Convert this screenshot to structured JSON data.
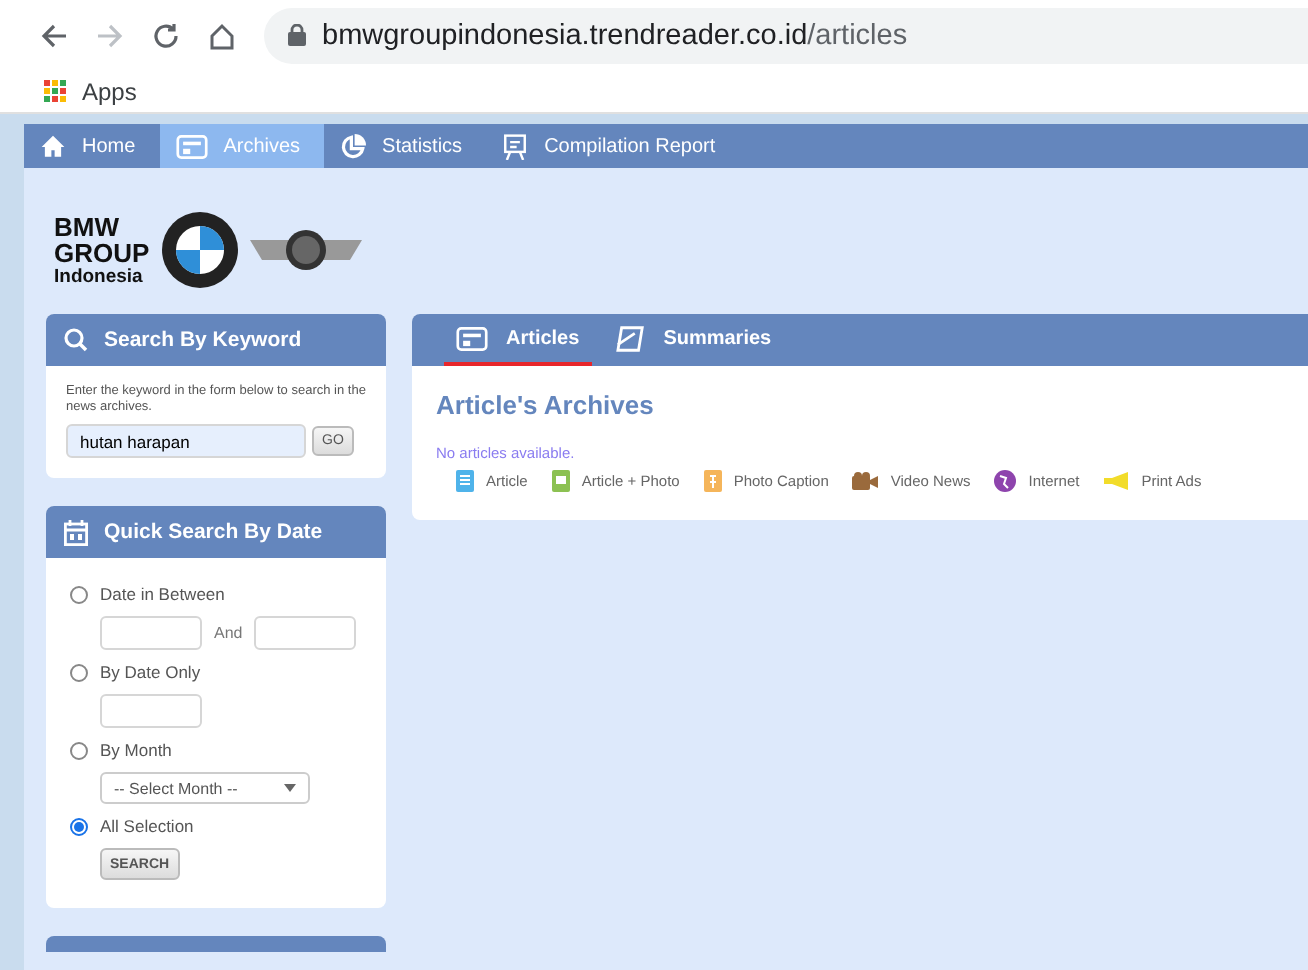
{
  "browser": {
    "url_host": "bmwgroupindonesia.trendreader.co.id",
    "url_path": "/articles",
    "bookmarks": [
      "Apps"
    ]
  },
  "nav": [
    {
      "label": "Home",
      "kind": "home",
      "selected": false
    },
    {
      "label": "Archives",
      "kind": "archive",
      "selected": true
    },
    {
      "label": "Statistics",
      "kind": "pie",
      "selected": false
    },
    {
      "label": "Compilation Report",
      "kind": "report",
      "selected": false
    }
  ],
  "brand": {
    "lines": [
      "BMW",
      "GROUP"
    ],
    "sub": "Indonesia"
  },
  "keyword_panel": {
    "title": "Search By Keyword",
    "hint": "Enter the keyword in the form below to search in the news archives.",
    "value": "hutan harapan",
    "button": "GO"
  },
  "date_panel": {
    "title": "Quick Search By Date",
    "options": [
      {
        "label": "Date in Between",
        "kind": "range",
        "selected": false,
        "joiner": "And"
      },
      {
        "label": "By Date Only",
        "kind": "single",
        "selected": false
      },
      {
        "label": "By Month",
        "kind": "month",
        "selected": false,
        "select": "-- Select Month --"
      },
      {
        "label": "All Selection",
        "kind": "none",
        "selected": true
      }
    ],
    "button": "SEARCH"
  },
  "content_tabs": [
    {
      "label": "Articles",
      "kind": "archive",
      "selected": true
    },
    {
      "label": "Summaries",
      "kind": "summary",
      "selected": false
    }
  ],
  "archive": {
    "title": "Article's Archives",
    "message": "No articles available.",
    "legend": [
      {
        "label": "Article",
        "kind": "doc",
        "color": "#4fb3ea"
      },
      {
        "label": "Article + Photo",
        "kind": "photo",
        "color": "#8cc152"
      },
      {
        "label": "Photo Caption",
        "kind": "caption",
        "color": "#f5b55a"
      },
      {
        "label": "Video News",
        "kind": "video",
        "color": "#9a6a3c"
      },
      {
        "label": "Internet",
        "kind": "globe",
        "color": "#8e44ad"
      },
      {
        "label": "Print Ads",
        "kind": "megaphone",
        "color": "#f2dc2a"
      }
    ]
  }
}
